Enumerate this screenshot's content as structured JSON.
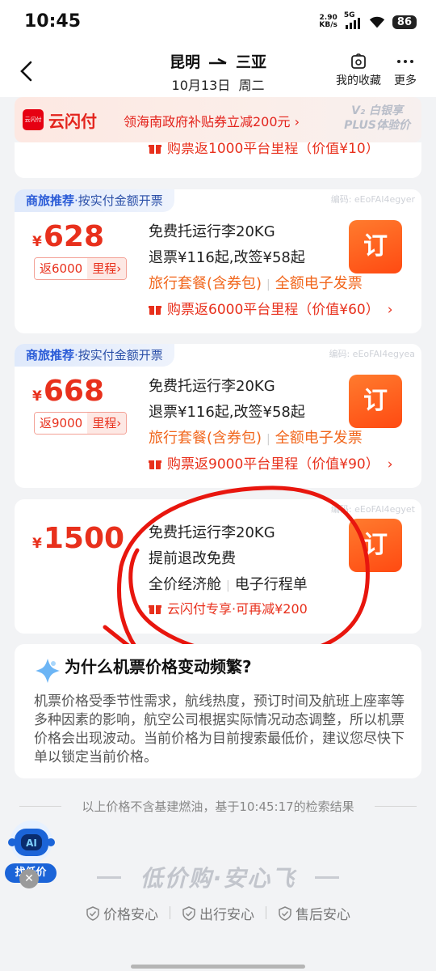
{
  "status": {
    "time": "10:45",
    "speed": "2.90",
    "speed_unit": "KB/s",
    "network": "5G",
    "battery": "86"
  },
  "header": {
    "from": "昆明",
    "to": "三亚",
    "date": "10月13日",
    "weekday": "周二",
    "favorites": "我的收藏",
    "more": "更多"
  },
  "banner": {
    "brand": "云闪付",
    "text": "领海南政府补贴券立减200元 ›",
    "badge_line1": "V₂ 白银享",
    "badge_line2": "PLUS体验价"
  },
  "top_partial": {
    "text": "购票返1000平台里程（价值¥10）"
  },
  "fares": [
    {
      "tag_bold": "商旅推荐",
      "tag_rest": "按实付金额开票",
      "code": "编码: eEoFAI4egyer",
      "currency": "¥",
      "price": "628",
      "rebate_a": "返6000",
      "rebate_b": "里程›",
      "line1": "免费托运行李20KG",
      "line2": "退票¥116起,改签¥58起",
      "line3a": "旅行套餐(含券包)",
      "line3b": "全额电子发票",
      "perk": "购票返6000平台里程（价值¥60）",
      "book": "订"
    },
    {
      "tag_bold": "商旅推荐",
      "tag_rest": "按实付金额开票",
      "code": "编码: eEoFAI4egyea",
      "currency": "¥",
      "price": "668",
      "rebate_a": "返9000",
      "rebate_b": "里程›",
      "line1": "免费托运行李20KG",
      "line2": "退票¥116起,改签¥58起",
      "line3a": "旅行套餐(含券包)",
      "line3b": "全额电子发票",
      "perk": "购票返9000平台里程（价值¥90）",
      "book": "订"
    },
    {
      "code": "编码: eEoFAI4egyet",
      "currency": "¥",
      "price": "1500",
      "line1": "免费托运行李20KG",
      "line2": "提前退改免费",
      "line3a": "全价经济舱",
      "line3b": "电子行程单",
      "perk": "云闪付专享·可再减¥200",
      "book": "订"
    }
  ],
  "info": {
    "title": "为什么机票价格变动频繁?",
    "body": "机票价格受季节性需求，航线热度，预订时间及航班上座率等多种因素的影响，航空公司根据实际情况动态调整，所以机票价格会出现波动。当前价格为目前搜索最低价，建议您尽快下单以锁定当前价格。"
  },
  "footnote": "以上价格不含基建燃油，基于10:45:17的检索结果",
  "ai": {
    "label": "AI",
    "button": "找低价"
  },
  "slogan": "低价购·安心飞",
  "guarantees": [
    "价格安心",
    "出行安心",
    "售后安心"
  ]
}
